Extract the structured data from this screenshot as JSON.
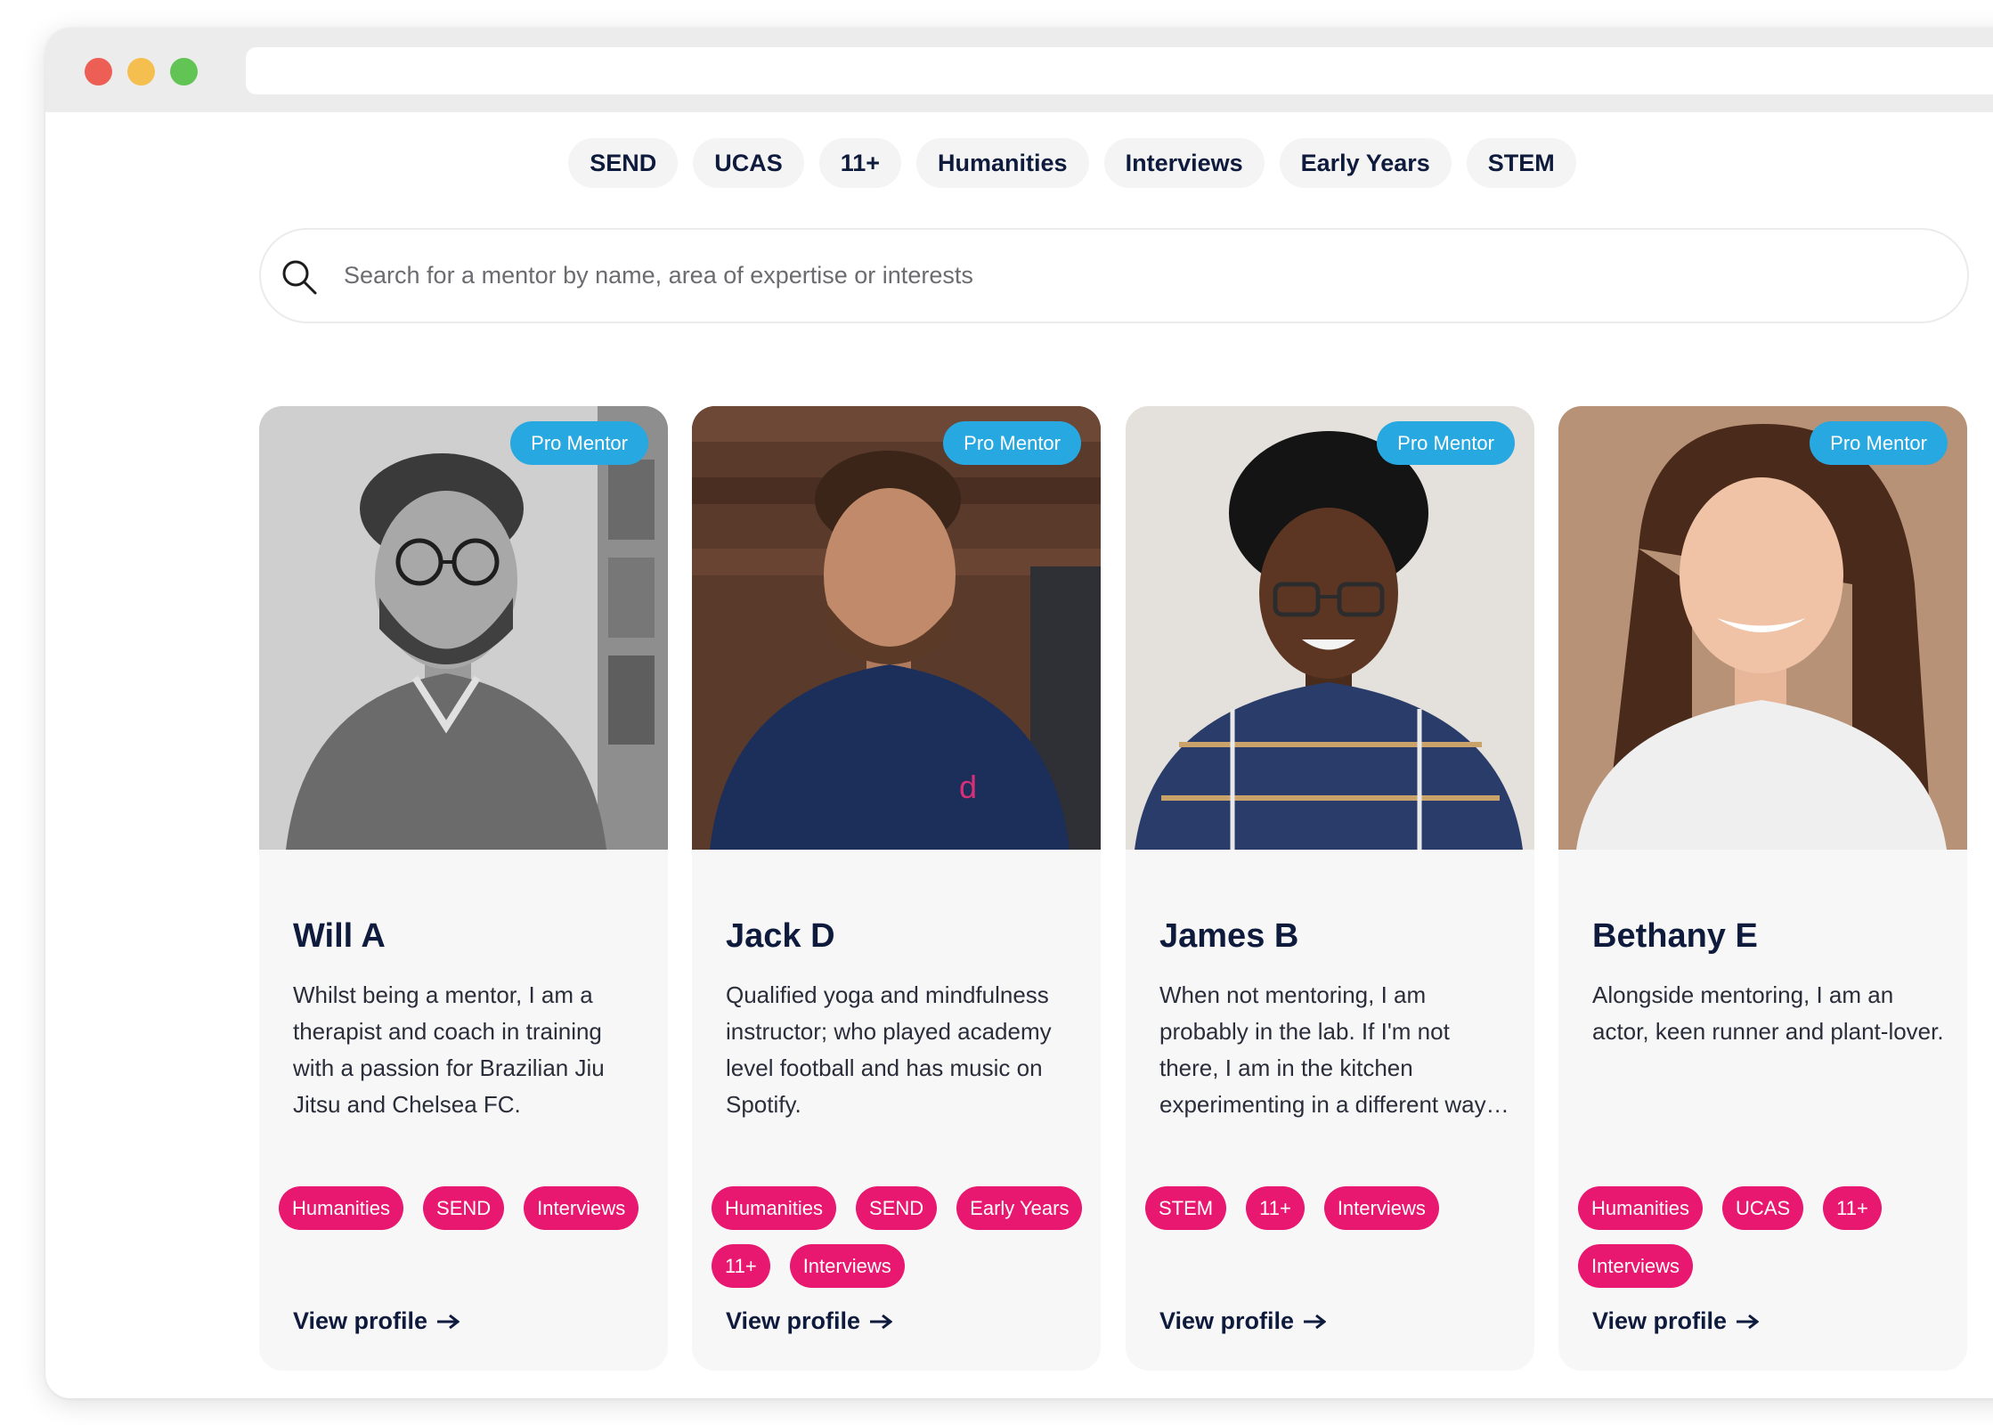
{
  "filters": [
    "SEND",
    "UCAS",
    "11+",
    "Humanities",
    "Interviews",
    "Early Years",
    "STEM"
  ],
  "search": {
    "placeholder": "Search for a mentor by name, area of expertise or interests"
  },
  "mentors": [
    {
      "name": "Will A",
      "badge": "Pro Mentor",
      "bio": "Whilst being a mentor, I am a therapist and coach in training with a passion for Brazilian Jiu Jitsu and Chelsea FC.",
      "tags": [
        "Humanities",
        "SEND",
        "Interviews"
      ],
      "link": "View profile"
    },
    {
      "name": "Jack D",
      "badge": "Pro Mentor",
      "bio": "Qualified yoga and mindfulness instructor; who played academy level football and has music on Spotify.",
      "tags": [
        "Humanities",
        "SEND",
        "Early Years",
        "11+",
        "Interviews"
      ],
      "link": "View profile"
    },
    {
      "name": "James B",
      "badge": "Pro Mentor",
      "bio": "When not mentoring, I am probably in the lab. If I'm not there, I am in the kitchen experimenting in a different way…",
      "tags": [
        "STEM",
        "11+",
        "Interviews"
      ],
      "link": "View profile"
    },
    {
      "name": "Bethany E",
      "badge": "Pro Mentor",
      "bio": "Alongside mentoring, I am an actor, keen runner and plant-lover.",
      "tags": [
        "Humanities",
        "UCAS",
        "11+",
        "Interviews"
      ],
      "link": "View profile"
    }
  ],
  "colors": {
    "badge": "#28a8e0",
    "tag": "#e8176f",
    "text": "#0f1b3d"
  }
}
